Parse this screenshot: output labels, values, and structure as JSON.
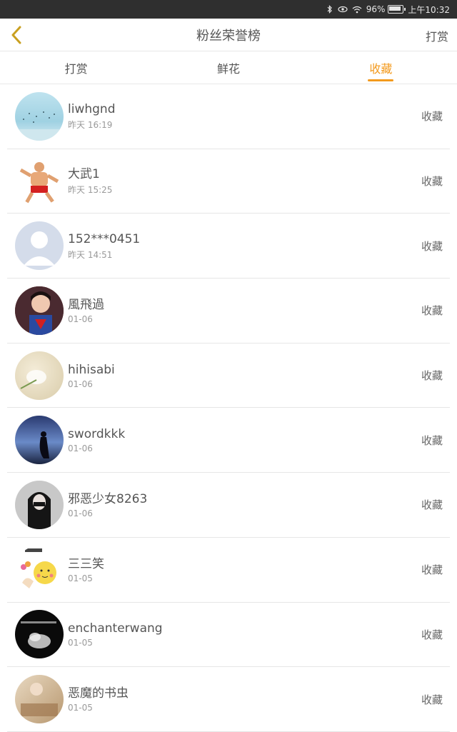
{
  "status": {
    "battery": "96%",
    "time": "上午10:32"
  },
  "header": {
    "title": "粉丝荣誉榜",
    "right_action": "打赏"
  },
  "tabs": [
    {
      "label": "打赏",
      "active": false
    },
    {
      "label": "鲜花",
      "active": false
    },
    {
      "label": "收藏",
      "active": true
    }
  ],
  "colors": {
    "accent": "#f39a1d"
  },
  "fans": [
    {
      "name": "liwhgnd",
      "time": "昨天 16:19",
      "action": "收藏"
    },
    {
      "name": "大武1",
      "time": "昨天 15:25",
      "action": "收藏"
    },
    {
      "name": "152***0451",
      "time": "昨天 14:51",
      "action": "收藏"
    },
    {
      "name": "風飛過",
      "time": "01-06",
      "action": "收藏"
    },
    {
      "name": "hihisabi",
      "time": "01-06",
      "action": "收藏"
    },
    {
      "name": "swordkkk",
      "time": "01-06",
      "action": "收藏"
    },
    {
      "name": "邪恶少女8263",
      "time": "01-06",
      "action": "收藏"
    },
    {
      "name": "三三笑",
      "time": "01-05",
      "action": "收藏"
    },
    {
      "name": "enchanterwang",
      "time": "01-05",
      "action": "收藏"
    },
    {
      "name": "恶魔的书虫",
      "time": "01-05",
      "action": "收藏"
    }
  ]
}
